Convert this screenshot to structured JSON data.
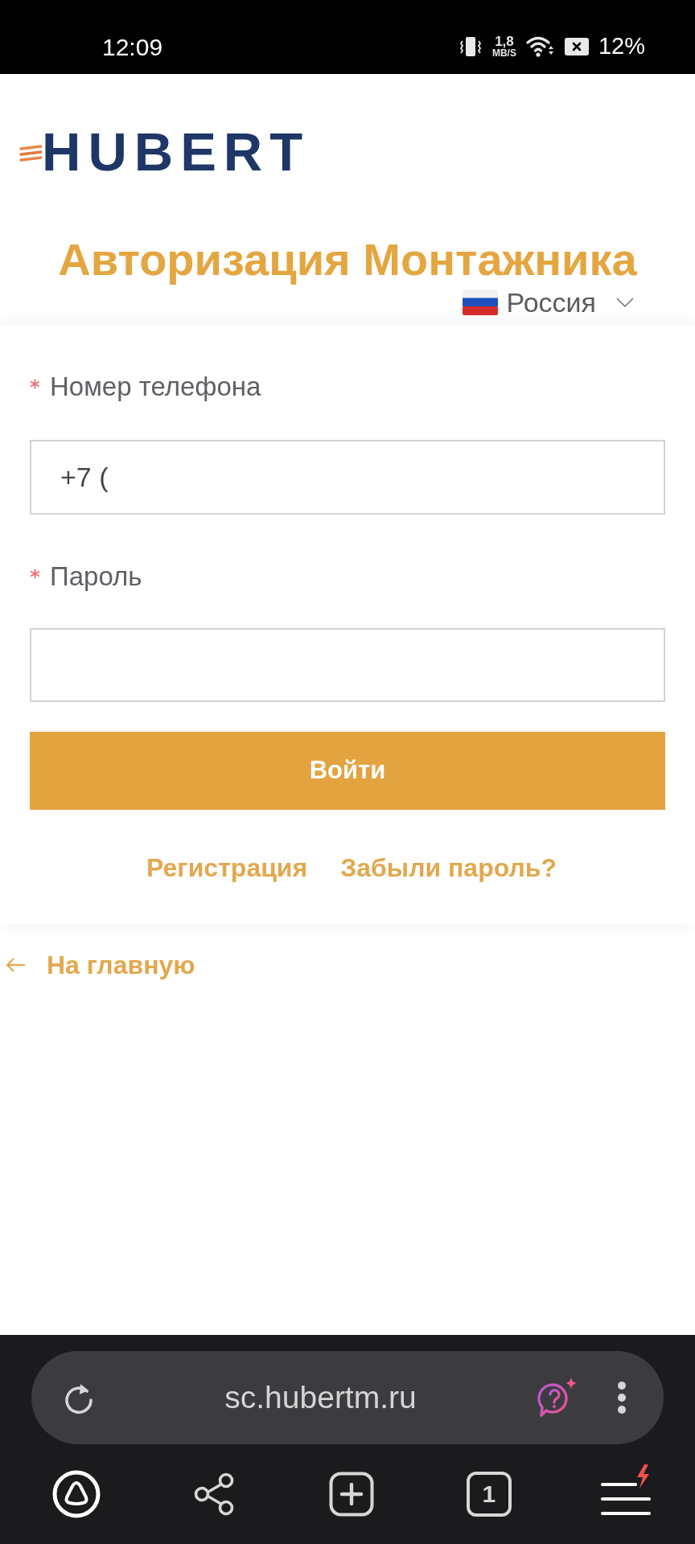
{
  "status_bar": {
    "time": "12:09",
    "network_speed": "1,8",
    "network_speed_unit": "MB/S",
    "battery": "12%"
  },
  "logo": {
    "text": "HUBERT"
  },
  "header": {
    "title": "Авторизация Монтажника",
    "country": "Россия"
  },
  "form": {
    "fields": [
      {
        "label": "Номер телефона",
        "required": true,
        "value": "+7 ("
      },
      {
        "label": "Пароль",
        "required": true
      }
    ],
    "submit": "Войти",
    "links": [
      "Регистрация",
      "Забыли пароль?"
    ]
  },
  "back_link": "На главную",
  "browser": {
    "url": "sc.hubertm.ru",
    "tab_count": "1"
  }
}
